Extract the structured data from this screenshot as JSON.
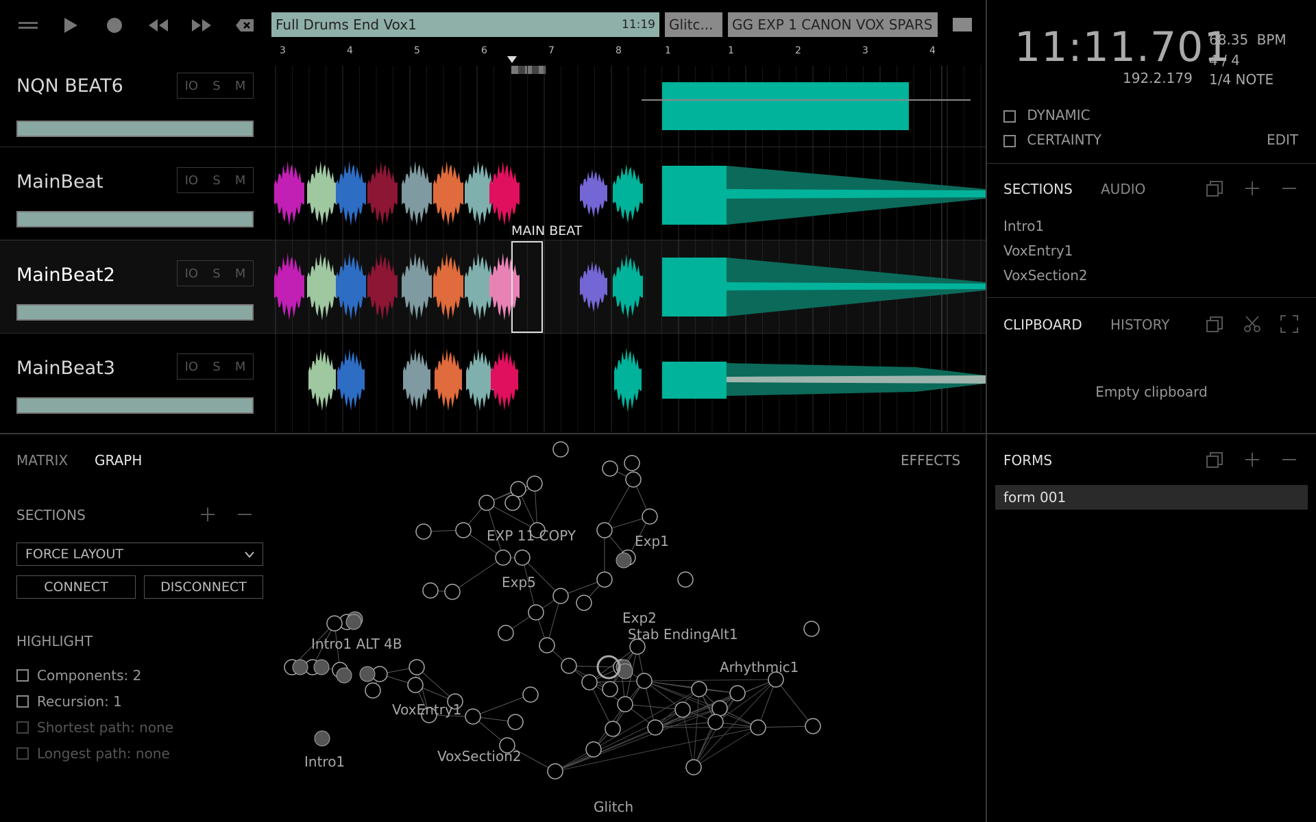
{
  "transport": {
    "icons": [
      "menu-icon",
      "play-icon",
      "record-icon",
      "rewind-icon",
      "fast-forward-icon",
      "backspace-icon"
    ]
  },
  "clips": [
    {
      "title": "Full Drums End Vox1",
      "time": "11:19",
      "color": "#8fb0a8"
    },
    {
      "title": "Glitc...",
      "color": "#8a8a8a"
    },
    {
      "title": "GG EXP 1 CANON VOX SPARS",
      "color": "#8a8a8a"
    }
  ],
  "ruler": [
    "3",
    "4",
    "5",
    "6",
    "7",
    "8",
    "1",
    "1",
    "2",
    "3",
    "4"
  ],
  "tracks": [
    {
      "name": "NQN BEAT6",
      "io": "IO",
      "s": "S",
      "m": "M"
    },
    {
      "name": "MainBeat",
      "io": "IO",
      "s": "S",
      "m": "M"
    },
    {
      "name": "MainBeat2",
      "io": "IO",
      "s": "S",
      "m": "M"
    },
    {
      "name": "MainBeat3",
      "io": "IO",
      "s": "S",
      "m": "M"
    }
  ],
  "selection_label": "MAIN BEAT",
  "clock": {
    "time": "11:11.701",
    "position": "192.2.179",
    "bpm": "68.35",
    "bpm_unit": "BPM",
    "signature": "4 / 4",
    "quantize": "1/4 NOTE"
  },
  "options": {
    "dynamic": "DYNAMIC",
    "certainty": "CERTAINTY",
    "edit": "EDIT"
  },
  "sections_panel": {
    "tab_sections": "SECTIONS",
    "tab_audio": "AUDIO",
    "items": [
      "Intro1",
      "VoxEntry1",
      "VoxSection2"
    ]
  },
  "clipboard_panel": {
    "tab_clipboard": "CLIPBOARD",
    "tab_history": "HISTORY",
    "empty": "Empty clipboard"
  },
  "bottom": {
    "tab_matrix": "MATRIX",
    "tab_graph": "GRAPH",
    "effects": "EFFECTS",
    "sections": "SECTIONS",
    "layout_select": "FORCE LAYOUT",
    "connect": "CONNECT",
    "disconnect": "DISCONNECT",
    "highlight": "HIGHLIGHT",
    "highlight_items": [
      "Components: 2",
      "Recursion: 1",
      "Shortest path: none",
      "Longest path: none"
    ]
  },
  "graph_labels": [
    "EXP 11 COPY",
    "Exp1",
    "Exp5",
    "Exp2",
    "Stab EndingAlt1",
    "Intro1 ALT 4B",
    "Arhythmic1",
    "VoxEntry1",
    "Intro1",
    "VoxSection2",
    "Glitch"
  ],
  "forms_panel": {
    "title": "FORMS",
    "items": [
      "form 001"
    ]
  },
  "colors": {
    "accent": "#00b39a",
    "clip_bg": "#8fb0a8",
    "background": "#000000"
  }
}
